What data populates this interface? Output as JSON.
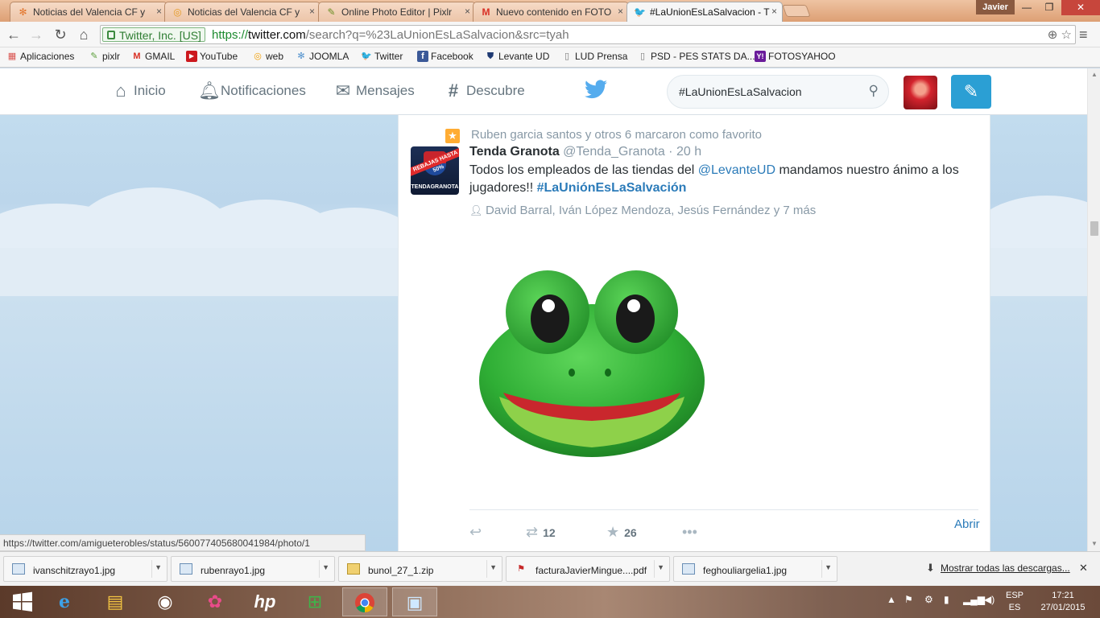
{
  "browser": {
    "tabs": [
      {
        "title": "Noticias del Valencia CF y",
        "icon": "joomla-icon",
        "active": false
      },
      {
        "title": "Noticias del Valencia CF y",
        "icon": "site-icon",
        "active": false
      },
      {
        "title": "Online Photo Editor | Pixlr",
        "icon": "pixlr-icon",
        "active": false
      },
      {
        "title": "Nuevo contenido en FOTO",
        "icon": "gmail-icon",
        "active": false
      },
      {
        "title": "#LaUnionEsLaSalvacion - T",
        "icon": "twitter-icon",
        "active": true
      }
    ],
    "tab_close": "×",
    "user_name": "Javier",
    "window_controls": {
      "minimize": "—",
      "maximize": "❐",
      "close": "✕"
    },
    "ev_certificate": "Twitter, Inc. [US]",
    "url_scheme": "https://",
    "url_host": "twitter.com",
    "url_path": "/search?q=%23LaUnionEsLaSalvacion&src=tyah"
  },
  "bookmarks": [
    {
      "label": "Aplicaciones",
      "icon": "apps-grid-icon",
      "color": "#d9534f"
    },
    {
      "label": "pixlr",
      "icon": "pixlr-icon",
      "color": "#5a9e3a"
    },
    {
      "label": "GMAIL",
      "icon": "gmail-icon",
      "color": "#d93025"
    },
    {
      "label": "YouTube",
      "icon": "youtube-icon",
      "color": "#cc181e"
    },
    {
      "label": "web",
      "icon": "web-icon",
      "color": "#f29f05"
    },
    {
      "label": "JOOMLA",
      "icon": "joomla-icon",
      "color": "#5091cd"
    },
    {
      "label": "Twitter",
      "icon": "twitter-icon",
      "color": "#55acee"
    },
    {
      "label": "Facebook",
      "icon": "facebook-icon",
      "color": "#3b5998"
    },
    {
      "label": "Levante UD",
      "icon": "levante-crest-icon",
      "color": "#1f3a73"
    },
    {
      "label": "LUD Prensa",
      "icon": "page-icon",
      "color": "#ffffff"
    },
    {
      "label": "PSD - PES STATS DA...",
      "icon": "page-icon",
      "color": "#ffffff"
    },
    {
      "label": "FOTOSYAHOO",
      "icon": "yahoo-icon",
      "color": "#6a1b9a"
    }
  ],
  "twitter": {
    "nav": {
      "home": "Inicio",
      "notifications": "Notificaciones",
      "messages": "Mensajes",
      "discover": "Descubre"
    },
    "search_value": "#LaUnionEsLaSalvacion",
    "brand_color": "#55acee"
  },
  "tweet": {
    "favorited_context": "Ruben garcia santos y otros 6 marcaron como favorito",
    "fullname": "Tenda Granota",
    "handle": "@Tenda_Granota",
    "time": "· 20 h",
    "text_before": "Todos los empleados de las tiendas del ",
    "mention": "@LevanteUD",
    "text_middle": " mandamos nuestro ánimo a los jugadores!! ",
    "hashtag": "#LaUniónEsLaSalvación",
    "tagged_people": "David Barral, Iván López Mendoza, Jesús Fernández y 7 más",
    "avatar_sale_text": "REBAJAS HASTA 50%",
    "avatar_brand_text": "TENDAGRANOTA",
    "media_description": "frog-emoji-image",
    "retweets": "12",
    "favorites": "26",
    "open_label": "Abrir"
  },
  "status_url": "https://twitter.com/amigueterobles/status/560077405680041984/photo/1",
  "downloads": {
    "items": [
      {
        "filename": "ivanschitzrayo1.jpg",
        "icon": "image-file-icon"
      },
      {
        "filename": "rubenrayo1.jpg",
        "icon": "image-file-icon"
      },
      {
        "filename": "bunol_27_1.zip",
        "icon": "zip-file-icon"
      },
      {
        "filename": "facturaJavierMingue....pdf",
        "icon": "pdf-file-icon"
      },
      {
        "filename": "feghouliargelia1.jpg",
        "icon": "image-file-icon"
      }
    ],
    "show_all": "Mostrar todas las descargas..."
  },
  "taskbar": {
    "apps": [
      "windows-start-icon",
      "internet-explorer-icon",
      "file-explorer-icon",
      "camera-app-icon",
      "photo-app-icon",
      "hp-icon",
      "store-icon",
      "chrome-icon",
      "photos-viewer-icon"
    ],
    "lang_top": "ESP",
    "lang_bottom": "ES",
    "time": "17:21",
    "date": "27/01/2015"
  }
}
